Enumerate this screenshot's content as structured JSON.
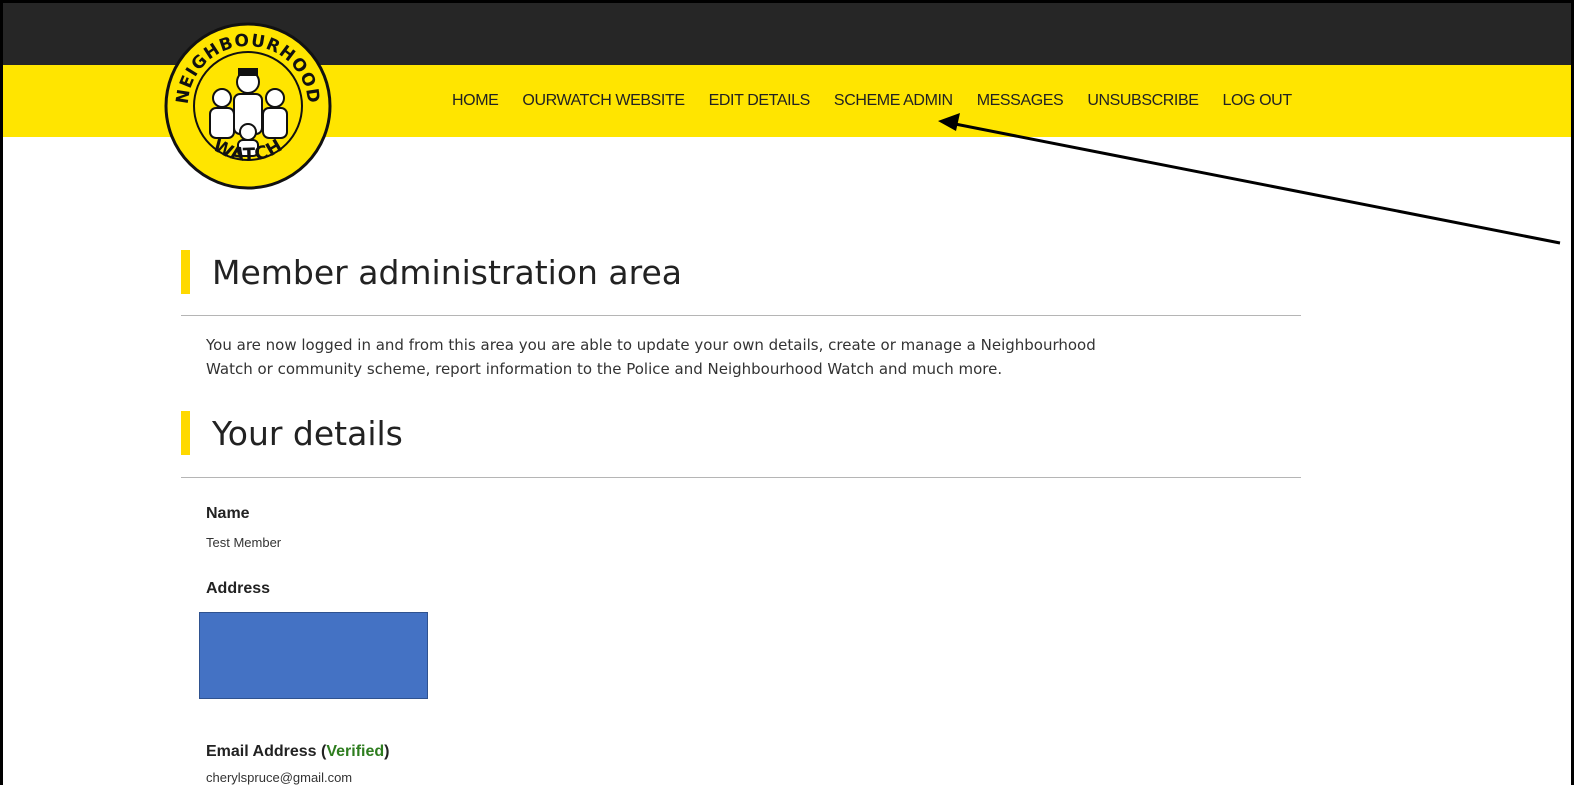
{
  "nav": {
    "items": [
      "HOME",
      "OURWATCH WEBSITE",
      "EDIT DETAILS",
      "SCHEME ADMIN",
      "MESSAGES",
      "UNSUBSCRIBE",
      "LOG OUT"
    ]
  },
  "logo": {
    "top_text": "NEIGHBOURHOOD",
    "bottom_text": "WATCH"
  },
  "main": {
    "title": "Member administration area",
    "intro_line1": "You are now logged in and from this area you are able to update your own details, create or manage a Neighbourhood",
    "intro_line2": "Watch or community scheme, report information to the Police and Neighbourhood Watch and much more.",
    "details_title": "Your details",
    "name_label": "Name",
    "name_value": "Test Member",
    "address_label": "Address",
    "email_label": "Email Address",
    "email_status": "Verified",
    "email_value": "cherylspruce@gmail.com"
  },
  "colors": {
    "topbar": "#262626",
    "navbar": "#ffe500",
    "accent": "#ffd900",
    "verified": "#2e7d1f",
    "redaction": "#4472c4"
  },
  "icons": [
    "neighbourhood-watch-logo",
    "annotation-arrow"
  ]
}
